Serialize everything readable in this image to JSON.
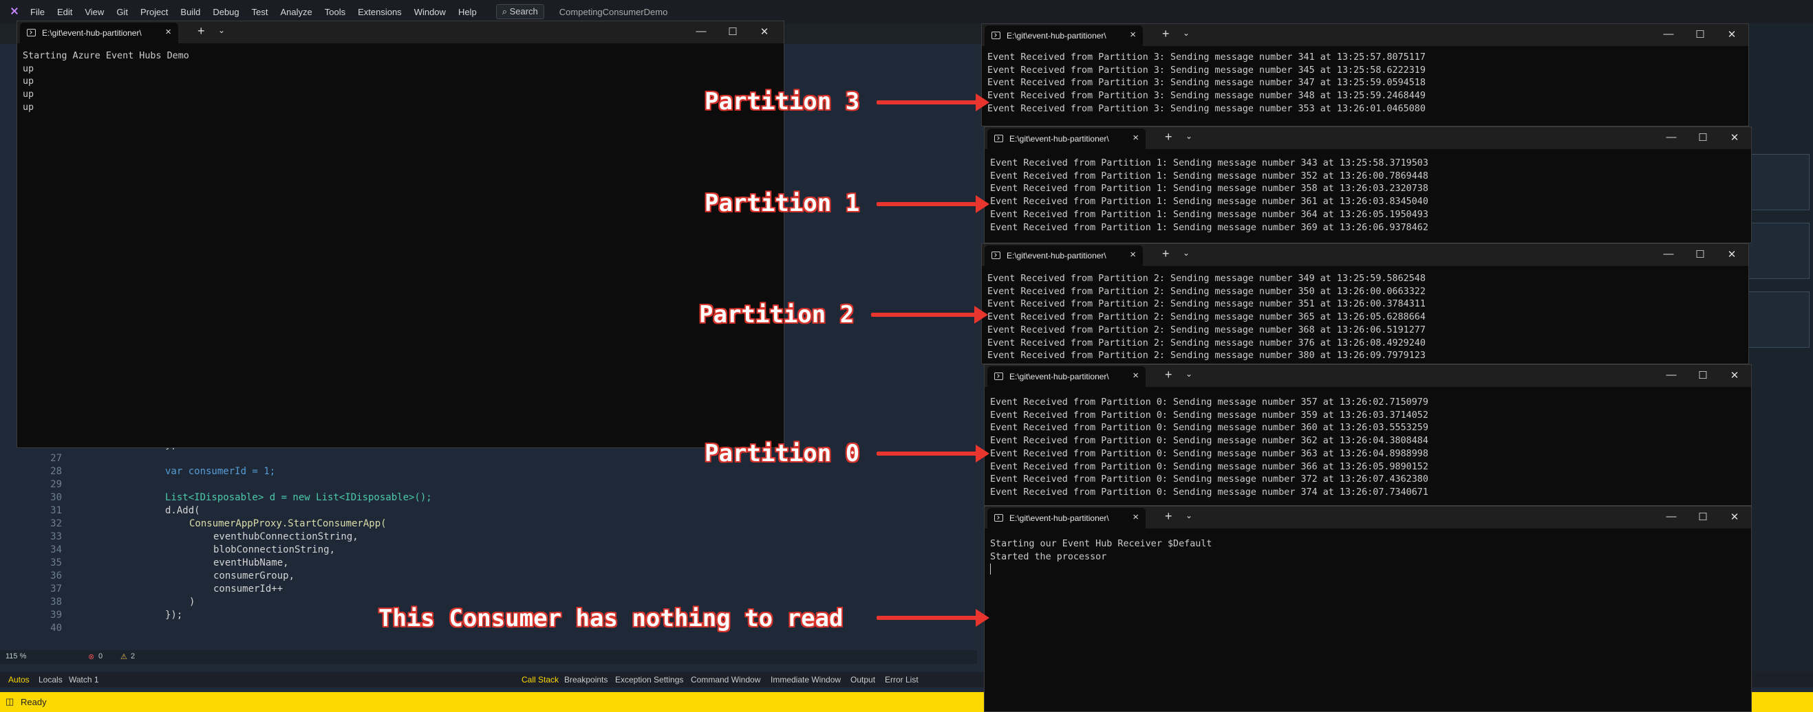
{
  "vs": {
    "logo": "VS",
    "menu": [
      "File",
      "Edit",
      "View",
      "Git",
      "Project",
      "Build",
      "Debug",
      "Test",
      "Analyze",
      "Tools",
      "Extensions",
      "Window",
      "Help"
    ],
    "search_label": "Search",
    "solution_name": "CompetingConsumerDemo",
    "zoom": "115 %",
    "errors": "0",
    "warnings": "2",
    "bottom_tabs": [
      "Autos",
      "Locals",
      "Watch 1"
    ],
    "debug_tabs": [
      "Call Stack",
      "Breakpoints",
      "Exception Settings",
      "Command Window",
      "Immediate Window",
      "Output",
      "Error List"
    ],
    "status": "Ready",
    "code": [
      {
        "n": "26",
        "text": "};"
      },
      {
        "n": "27",
        "text": ""
      },
      {
        "n": "28",
        "text": "var consumerId = 1;"
      },
      {
        "n": "29",
        "text": ""
      },
      {
        "n": "30",
        "text": "List<IDisposable> d = new List<IDisposable>();"
      },
      {
        "n": "31",
        "text": "d.Add("
      },
      {
        "n": "32",
        "text": "ConsumerAppProxy.StartConsumerApp("
      },
      {
        "n": "33",
        "text": "eventhubConnectionString,"
      },
      {
        "n": "34",
        "text": "blobConnectionString,"
      },
      {
        "n": "35",
        "text": "eventHubName,"
      },
      {
        "n": "36",
        "text": "consumerGroup,"
      },
      {
        "n": "37",
        "text": "consumerId++"
      },
      {
        "n": "38",
        "text": ")"
      },
      {
        "n": "39",
        "text": "});"
      },
      {
        "n": "40",
        "text": ""
      }
    ]
  },
  "terminals": [
    {
      "id": "main",
      "tab_title": "E:\\git\\event-hub-partitioner\\",
      "lines": [
        "Starting Azure Event Hubs Demo",
        "up",
        "up",
        "up",
        "up"
      ]
    },
    {
      "id": "p3",
      "tab_title": "E:\\git\\event-hub-partitioner\\",
      "lines": [
        "Event Received from Partition 3: Sending message number 341 at 13:25:57.8075117",
        "Event Received from Partition 3: Sending message number 345 at 13:25:58.6222319",
        "Event Received from Partition 3: Sending message number 347 at 13:25:59.0594518",
        "Event Received from Partition 3: Sending message number 348 at 13:25:59.2468449",
        "Event Received from Partition 3: Sending message number 353 at 13:26:01.0465080"
      ]
    },
    {
      "id": "p1",
      "tab_title": "E:\\git\\event-hub-partitioner\\",
      "lines": [
        "Event Received from Partition 1: Sending message number 343 at 13:25:58.3719503",
        "Event Received from Partition 1: Sending message number 352 at 13:26:00.7869448",
        "Event Received from Partition 1: Sending message number 358 at 13:26:03.2320738",
        "Event Received from Partition 1: Sending message number 361 at 13:26:03.8345040",
        "Event Received from Partition 1: Sending message number 364 at 13:26:05.1950493",
        "Event Received from Partition 1: Sending message number 369 at 13:26:06.9378462"
      ]
    },
    {
      "id": "p2",
      "tab_title": "E:\\git\\event-hub-partitioner\\",
      "lines": [
        "Event Received from Partition 2: Sending message number 349 at 13:25:59.5862548",
        "Event Received from Partition 2: Sending message number 350 at 13:26:00.0663322",
        "Event Received from Partition 2: Sending message number 351 at 13:26:00.3784311",
        "Event Received from Partition 2: Sending message number 365 at 13:26:05.6288664",
        "Event Received from Partition 2: Sending message number 368 at 13:26:06.5191277",
        "Event Received from Partition 2: Sending message number 376 at 13:26:08.4929240",
        "Event Received from Partition 2: Sending message number 380 at 13:26:09.7979123"
      ]
    },
    {
      "id": "p0",
      "tab_title": "E:\\git\\event-hub-partitioner\\",
      "lines": [
        "Event Received from Partition 0: Sending message number 357 at 13:26:02.7150979",
        "Event Received from Partition 0: Sending message number 359 at 13:26:03.3714052",
        "Event Received from Partition 0: Sending message number 360 at 13:26:03.5553259",
        "Event Received from Partition 0: Sending message number 362 at 13:26:04.3808484",
        "Event Received from Partition 0: Sending message number 363 at 13:26:04.8988998",
        "Event Received from Partition 0: Sending message number 366 at 13:26:05.9890152",
        "Event Received from Partition 0: Sending message number 372 at 13:26:07.4362380",
        "Event Received from Partition 0: Sending message number 374 at 13:26:07.7340671"
      ]
    },
    {
      "id": "idle",
      "tab_title": "E:\\git\\event-hub-partitioner\\",
      "lines": [
        "Starting our Event Hub Receiver $Default",
        "Started the processor"
      ]
    }
  ],
  "annotations": {
    "p3": "Partition 3",
    "p1": "Partition 1",
    "p2": "Partition 2",
    "p0": "Partition 0",
    "idle": "This Consumer has nothing to read"
  },
  "colors": {
    "arrow": "#e8352e",
    "status_bar": "#fcd900",
    "terminal_bg": "#0c0c0c"
  }
}
